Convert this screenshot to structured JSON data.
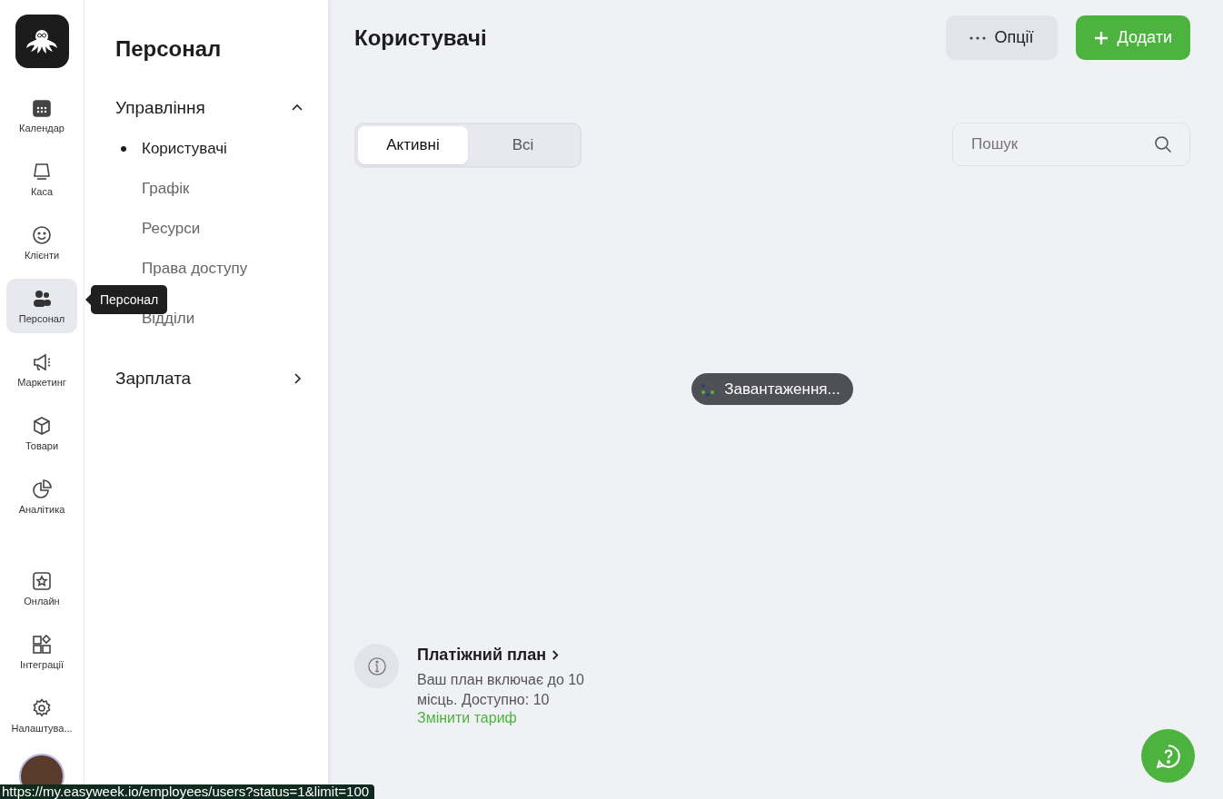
{
  "rail": {
    "items": [
      {
        "label": "Календар",
        "kind": "calendar",
        "selected": false
      },
      {
        "label": "Каса",
        "kind": "register",
        "selected": false
      },
      {
        "label": "Клієнти",
        "kind": "smile",
        "selected": false
      },
      {
        "label": "Персонал",
        "kind": "people",
        "selected": true
      },
      {
        "label": "Маркетинг",
        "kind": "megaphone",
        "selected": false
      },
      {
        "label": "Товари",
        "kind": "box",
        "selected": false
      },
      {
        "label": "Аналітика",
        "kind": "pie",
        "selected": false
      }
    ],
    "bottom_items": [
      {
        "label": "Онлайн",
        "kind": "star",
        "selected": false
      },
      {
        "label": "Інтеграції",
        "kind": "apps",
        "selected": false
      },
      {
        "label": "Налаштува...",
        "kind": "gear",
        "selected": false
      }
    ]
  },
  "tooltip": "Персонал",
  "section": {
    "title": "Персонал",
    "groups": [
      {
        "label": "Управління",
        "expanded": true,
        "children": [
          {
            "label": "Користувачі",
            "selected": true
          },
          {
            "label": "Графік",
            "selected": false
          },
          {
            "label": "Ресурси",
            "selected": false
          },
          {
            "label": "Права доступу",
            "selected": false
          },
          {
            "label": "Відділи",
            "selected": false
          }
        ]
      },
      {
        "label": "Зарплата",
        "expanded": false
      }
    ]
  },
  "page": {
    "title": "Користувачі",
    "options_button": "Опції",
    "add_button": "Додати",
    "tabs": [
      {
        "label": "Активні",
        "selected": true
      },
      {
        "label": "Всі",
        "selected": false
      }
    ],
    "search": {
      "placeholder": "Пошук"
    },
    "loading": "Завантаження...",
    "plan": {
      "title": "Платіжний план",
      "text": "Ваш план включає до 10 місць. Доступно: 10",
      "link": "Змінити тариф"
    }
  },
  "status_url": "https://my.easyweek.io/employees/users?status=1&limit=100"
}
